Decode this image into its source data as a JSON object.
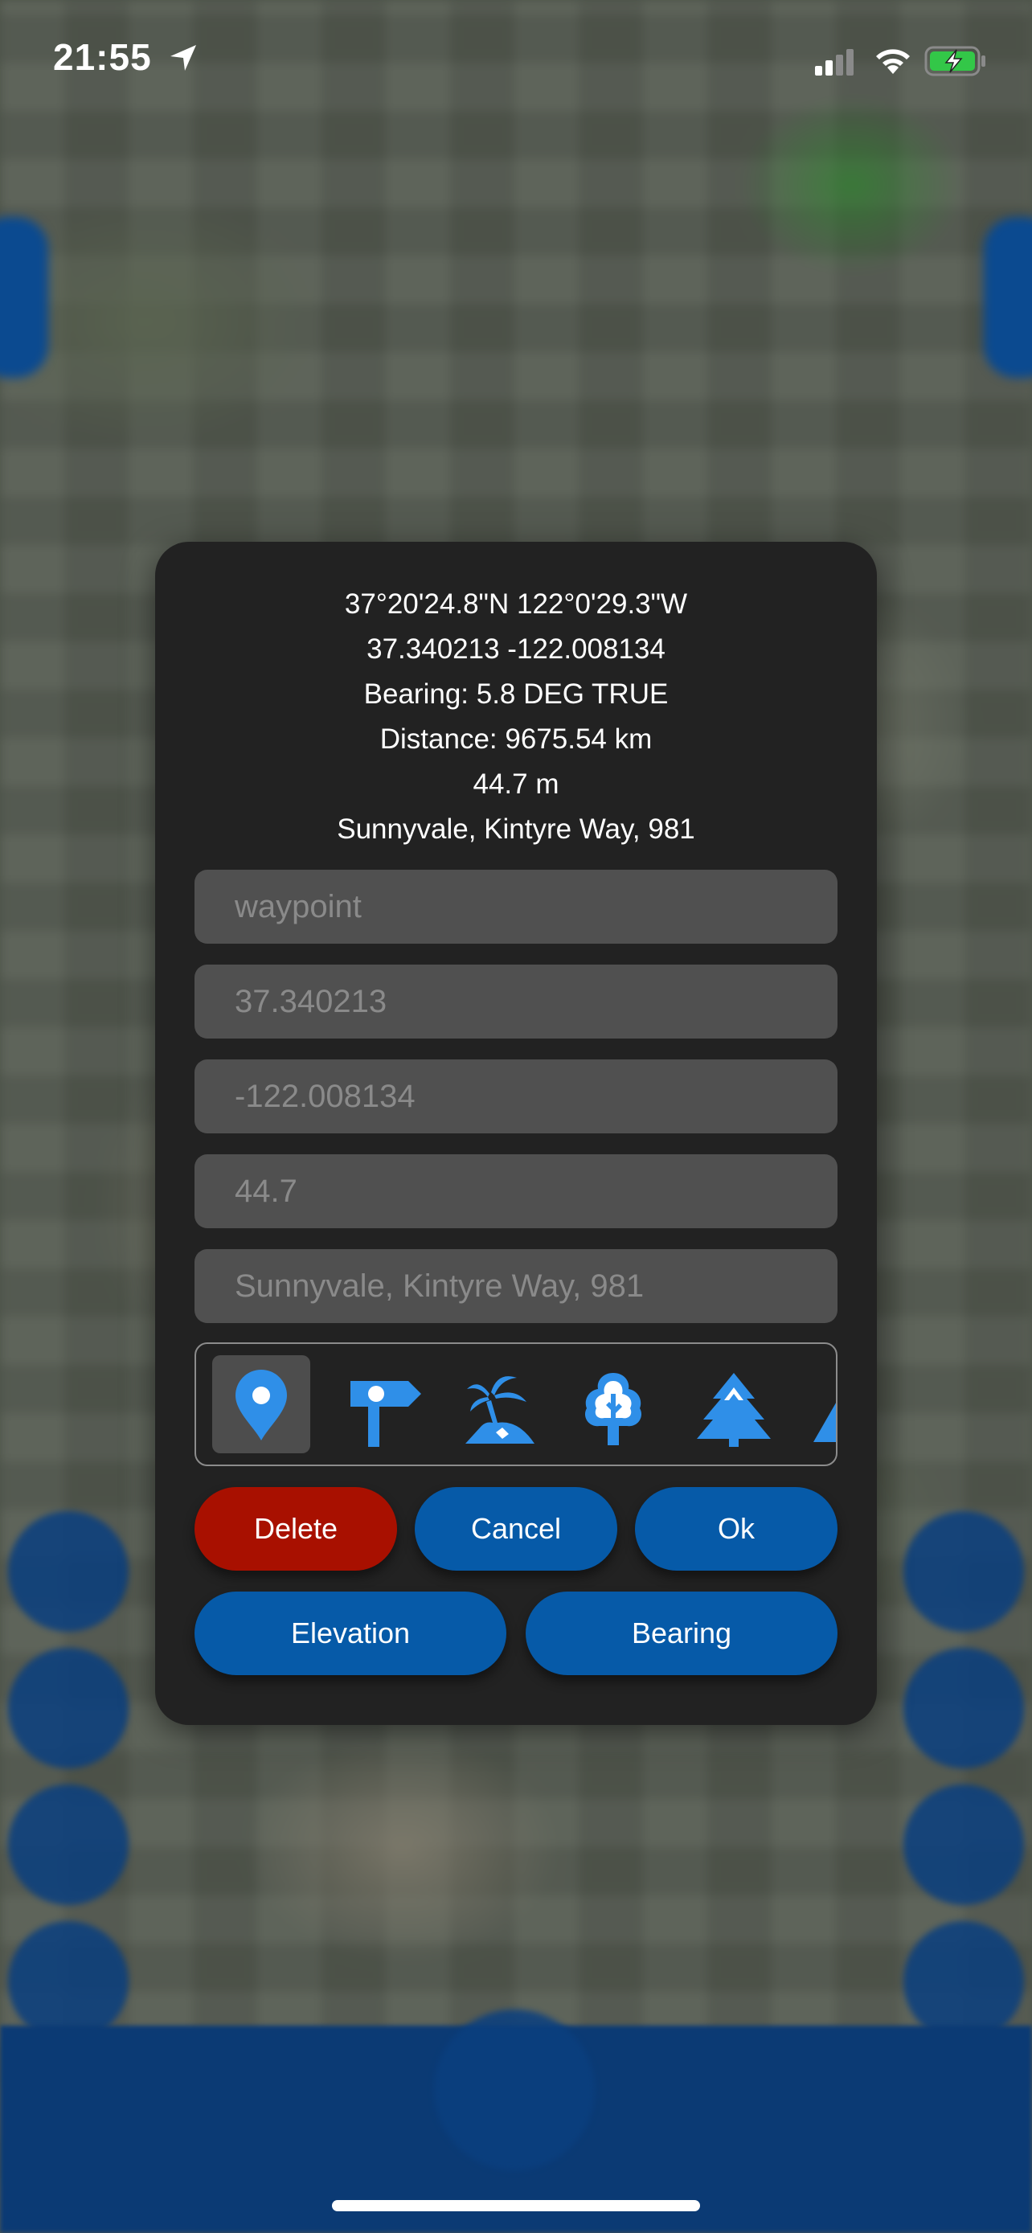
{
  "status_bar": {
    "time": "21:55"
  },
  "dialog": {
    "info_lines": [
      "37°20'24.8\"N  122°0'29.3\"W",
      "37.340213  -122.008134",
      "Bearing: 5.8 DEG TRUE",
      "Distance: 9675.54 km",
      "44.7 m",
      "Sunnyvale, Kintyre Way, 981"
    ],
    "fields": {
      "name_placeholder": "waypoint",
      "latitude": "37.340213",
      "longitude": "-122.008134",
      "elevation": "44.7",
      "address": "Sunnyvale, Kintyre Way, 981"
    },
    "icons": [
      "map-pin-icon",
      "signpost-icon",
      "palm-island-icon",
      "deciduous-tree-icon",
      "pine-tree-icon",
      "mountain-icon"
    ],
    "buttons": {
      "delete": "Delete",
      "cancel": "Cancel",
      "ok": "Ok",
      "elevation": "Elevation",
      "bearing": "Bearing"
    }
  },
  "colors": {
    "accent_blue": "#065aa8",
    "icon_blue": "#2f8fe8",
    "danger_red": "#a81000",
    "dialog_bg": "#222222",
    "field_bg": "#505050"
  }
}
